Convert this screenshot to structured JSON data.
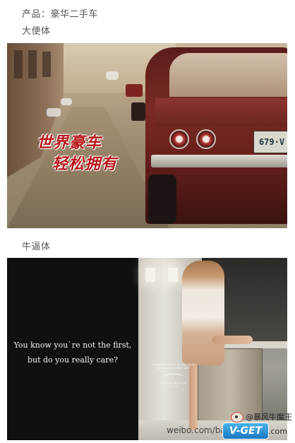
{
  "captions": {
    "product": "产品：豪华二手车",
    "style1": "大便体",
    "style2": "牛逼体"
  },
  "ad1": {
    "slogan_line1": "世界豪车",
    "slogan_line2": "轻松拥有",
    "plate": "679·V",
    "slogan_color": "#b8161a"
  },
  "ad2": {
    "quote_line1": "You know you`re not the first,",
    "quote_line2": "but do you really care?",
    "poster_text_line1": "You know you're not the first,",
    "poster_text_line2": "but do you really care?",
    "poster_brand": "ASTON MARTIN",
    "poster_sub": "used cars"
  },
  "watermarks": {
    "weibo_handle": "@暴风牛魔王",
    "url": "weibo.com/ba",
    "vget": "V-GET",
    "com": ".com"
  }
}
